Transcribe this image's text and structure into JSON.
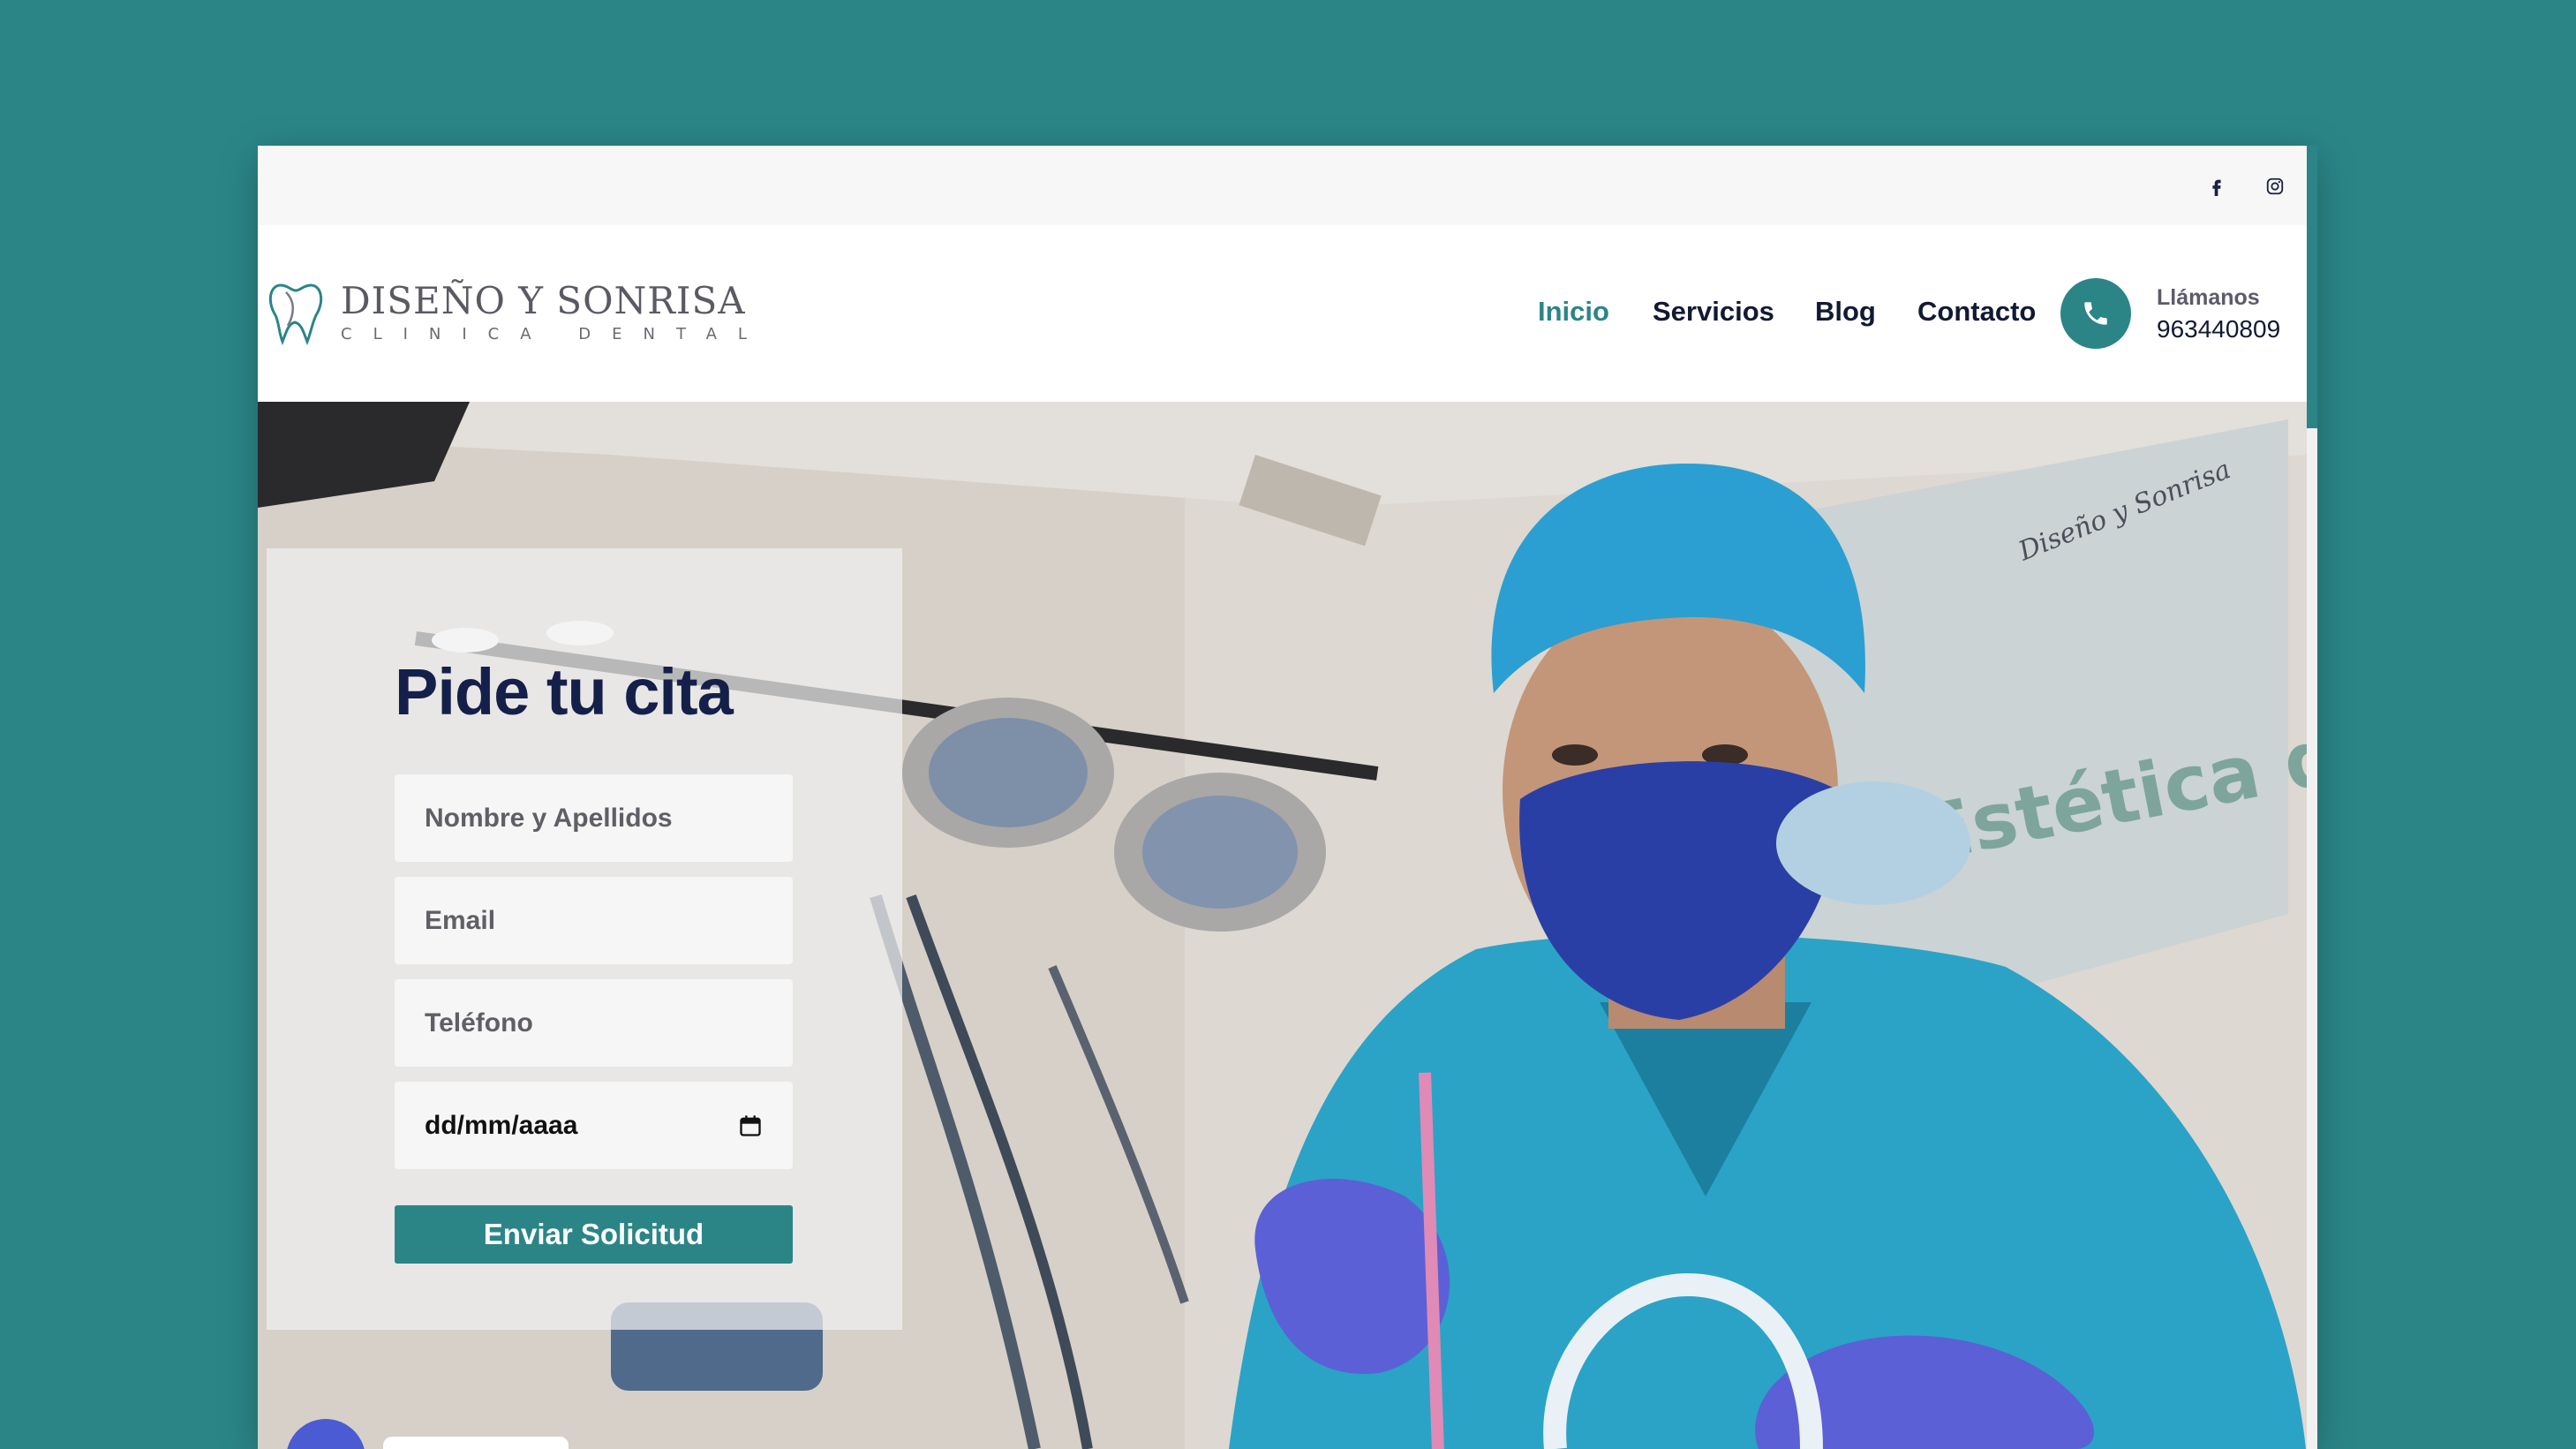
{
  "brand": {
    "name": "DISEÑO Y SONRISA",
    "tagline": "CLINICA DENTAL",
    "accent_color": "#2b8587",
    "navy_color": "#14204a"
  },
  "topbar": {
    "social": [
      {
        "name": "facebook",
        "icon": "facebook-icon"
      },
      {
        "name": "instagram",
        "icon": "instagram-icon"
      }
    ]
  },
  "nav": {
    "items": [
      {
        "label": "Inicio",
        "active": true
      },
      {
        "label": "Servicios",
        "active": false
      },
      {
        "label": "Blog",
        "active": false
      },
      {
        "label": "Contacto",
        "active": false
      }
    ],
    "phone_label": "Llámanos",
    "phone_number": "963440809"
  },
  "hero": {
    "wall_sign_text": "Estética dental",
    "wall_logo_text": "Diseño y Sonrisa",
    "form": {
      "title": "Pide tu cita",
      "name_placeholder": "Nombre y Apellidos",
      "email_placeholder": "Email",
      "phone_placeholder": "Teléfono",
      "date_placeholder": "dd/mm/aaaa",
      "submit_label": "Enviar Solicitud"
    }
  }
}
